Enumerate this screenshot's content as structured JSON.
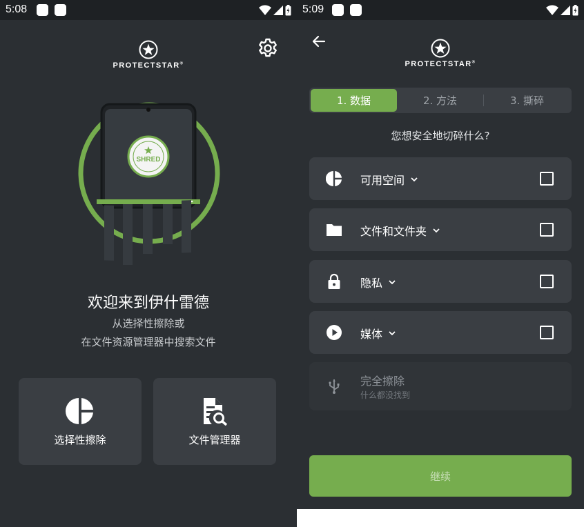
{
  "colors": {
    "background": "#2b2f33",
    "card": "#3a3e43",
    "accent_green": "#76ad4e",
    "statusbar": "#1e2124"
  },
  "left_screen": {
    "status_bar": {
      "time": "5:08"
    },
    "brand": {
      "name": "PROTECTSTAR",
      "trademark": "®"
    },
    "hero": {
      "badge_text": "SHRED",
      "icon": "shredder-phone-illustration"
    },
    "welcome": {
      "title": "欢迎来到伊什雷德",
      "line1": "从选择性擦除或",
      "line2": "在文件资源管理器中搜索文件"
    },
    "tiles": [
      {
        "label": "选择性擦除",
        "icon": "pie-chart-icon"
      },
      {
        "label": "文件管理器",
        "icon": "file-search-icon"
      }
    ]
  },
  "right_screen": {
    "status_bar": {
      "time": "5:09"
    },
    "brand": {
      "name": "PROTECTSTAR",
      "trademark": "®"
    },
    "steps": [
      {
        "label": "1. 数据",
        "active": true
      },
      {
        "label": "2. 方法",
        "active": false
      },
      {
        "label": "3. 撕碎",
        "active": false
      }
    ],
    "question": "您想安全地切碎什么?",
    "options": [
      {
        "label": "可用空间",
        "icon": "pie-chart-icon",
        "checked": false
      },
      {
        "label": "文件和文件夹",
        "icon": "folder-icon",
        "checked": false
      },
      {
        "label": "隐私",
        "icon": "lock-icon",
        "checked": false
      },
      {
        "label": "媒体",
        "icon": "play-icon",
        "checked": false
      }
    ],
    "full_wipe": {
      "label": "完全擦除",
      "subtitle": "什么都没找到",
      "icon": "usb-icon"
    },
    "continue_label": "继续"
  }
}
